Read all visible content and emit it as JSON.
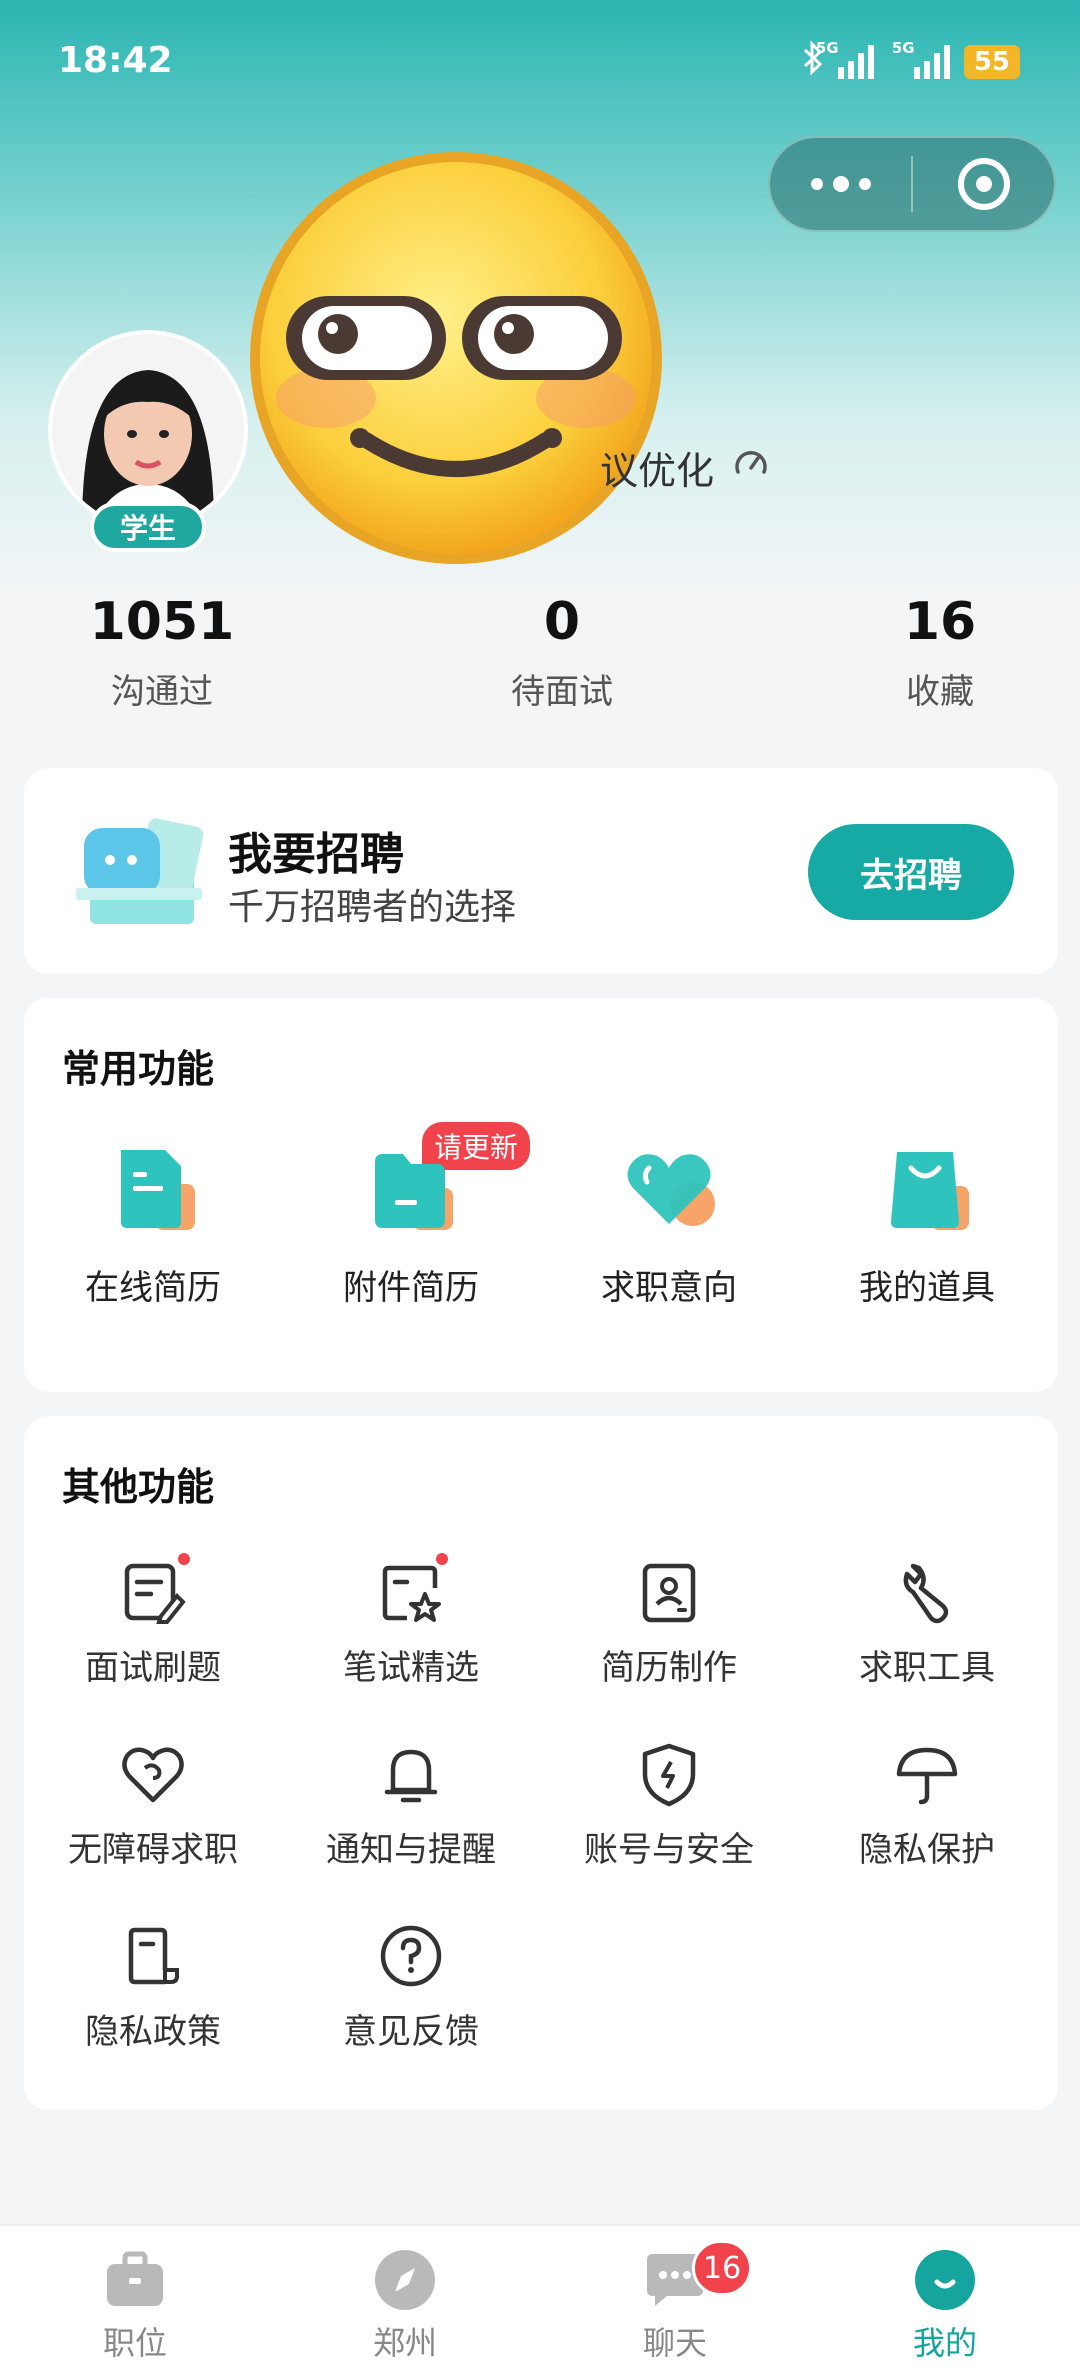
{
  "status_bar": {
    "time": "18:42",
    "signal1_label": "5G",
    "signal2_label": "5G",
    "battery": "55"
  },
  "profile": {
    "badge": "学生",
    "subtitle_partial": "议优化"
  },
  "stats": [
    {
      "value": "1051",
      "label": "沟通过"
    },
    {
      "value": "0",
      "label": "待面试"
    },
    {
      "value": "16",
      "label": "收藏"
    }
  ],
  "recruit": {
    "title": "我要招聘",
    "subtitle": "千万招聘者的选择",
    "button": "去招聘"
  },
  "common": {
    "title": "常用功能",
    "update_badge": "请更新",
    "items": [
      {
        "label": "在线简历",
        "icon": "resume-icon"
      },
      {
        "label": "附件简历",
        "icon": "folder-icon"
      },
      {
        "label": "求职意向",
        "icon": "heart-icon"
      },
      {
        "label": "我的道具",
        "icon": "bag-icon"
      }
    ]
  },
  "other": {
    "title": "其他功能",
    "items": [
      {
        "label": "面试刷题",
        "icon": "edit-note-icon"
      },
      {
        "label": "笔试精选",
        "icon": "star-doc-icon"
      },
      {
        "label": "简历制作",
        "icon": "profile-card-icon"
      },
      {
        "label": "求职工具",
        "icon": "wrench-icon"
      },
      {
        "label": "无障碍求职",
        "icon": "heart-outline-icon"
      },
      {
        "label": "通知与提醒",
        "icon": "bell-icon"
      },
      {
        "label": "账号与安全",
        "icon": "shield-icon"
      },
      {
        "label": "隐私保护",
        "icon": "umbrella-icon"
      },
      {
        "label": "隐私政策",
        "icon": "document-icon"
      },
      {
        "label": "意见反馈",
        "icon": "question-icon"
      }
    ]
  },
  "tabbar": {
    "items": [
      {
        "label": "职位",
        "icon": "briefcase-icon"
      },
      {
        "label": "郑州",
        "icon": "compass-icon"
      },
      {
        "label": "聊天",
        "icon": "chat-icon",
        "badge": "16"
      },
      {
        "label": "我的",
        "icon": "smile-icon",
        "active": true
      }
    ]
  },
  "colors": {
    "accent": "#17a9a3",
    "badge_red": "#f0434c",
    "header_top": "#2bb5b2"
  }
}
